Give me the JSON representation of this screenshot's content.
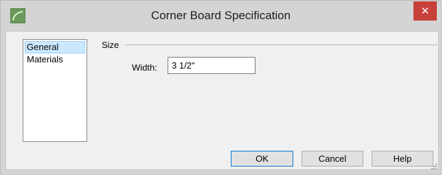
{
  "window": {
    "title": "Corner Board Specification",
    "close_label": "✕"
  },
  "nav": {
    "items": [
      {
        "label": "General",
        "selected": true
      },
      {
        "label": "Materials",
        "selected": false
      }
    ]
  },
  "size_group": {
    "label": "Size",
    "width_label": "Width:",
    "width_value": "3 1/2\""
  },
  "buttons": {
    "ok": "OK",
    "cancel": "Cancel",
    "help": "Help"
  },
  "icons": {
    "app": "corner-board-app-icon",
    "close": "close-icon",
    "resize": "resize-grip-icon"
  },
  "colors": {
    "close_button": "#c7403a",
    "selection": "#cce8ff",
    "dialog_face": "#f0f0f0"
  }
}
